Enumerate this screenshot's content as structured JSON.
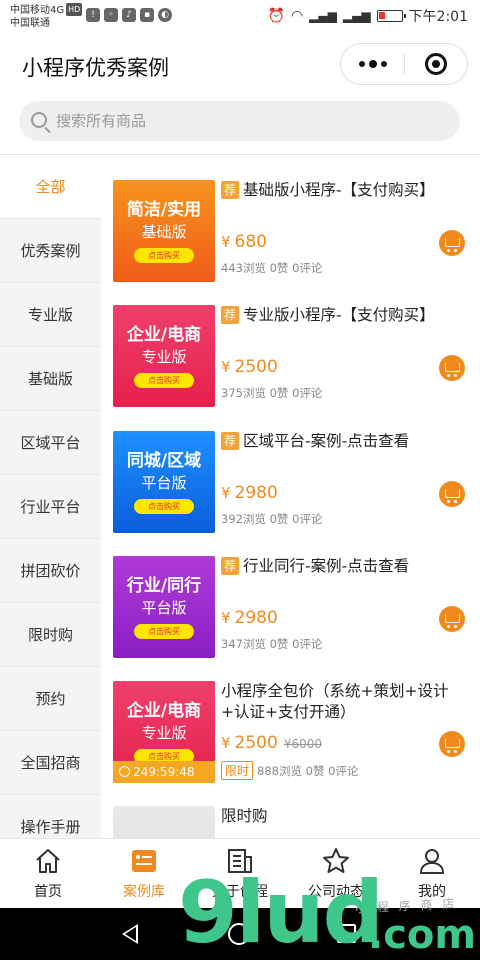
{
  "status_bar": {
    "carrier1": "中国移动4G",
    "hd": "HD",
    "carrier2": "中国联通",
    "time": "下午2:01"
  },
  "header": {
    "title": "小程序优秀案例"
  },
  "search": {
    "placeholder": "搜索所有商品"
  },
  "sidebar": {
    "items": [
      {
        "label": "全部"
      },
      {
        "label": "优秀案例"
      },
      {
        "label": "专业版"
      },
      {
        "label": "基础版"
      },
      {
        "label": "区域平台"
      },
      {
        "label": "行业平台"
      },
      {
        "label": "拼团砍价"
      },
      {
        "label": "限时购"
      },
      {
        "label": "预约"
      },
      {
        "label": "全国招商"
      },
      {
        "label": "操作手册"
      }
    ]
  },
  "products": [
    {
      "rec": "荐",
      "name": "基础版小程序-【支付购买】",
      "currency": "¥",
      "price": "680",
      "views": "443浏览",
      "likes": "0赞",
      "comments": "0评论",
      "thumb": {
        "line1": "简洁/实用",
        "line2": "基础版",
        "button": "点击购买",
        "color1": "#f7941d",
        "color2": "#f05a1a"
      }
    },
    {
      "rec": "荐",
      "name": "专业版小程序-【支付购买】",
      "currency": "¥",
      "price": "2500",
      "views": "375浏览",
      "likes": "0赞",
      "comments": "0评论",
      "thumb": {
        "line1": "企业/电商",
        "line2": "专业版",
        "button": "点击购买",
        "color1": "#f0406c",
        "color2": "#e5204c"
      }
    },
    {
      "rec": "荐",
      "name": "区域平台-案例-点击查看",
      "currency": "¥",
      "price": "2980",
      "views": "392浏览",
      "likes": "0赞",
      "comments": "0评论",
      "thumb": {
        "line1": "同城/区域",
        "line2": "平台版",
        "button": "点击购买",
        "color1": "#1e90ff",
        "color2": "#0a5fd8"
      }
    },
    {
      "rec": "荐",
      "name": "行业同行-案例-点击查看",
      "currency": "¥",
      "price": "2980",
      "views": "347浏览",
      "likes": "0赞",
      "comments": "0评论",
      "thumb": {
        "line1": "行业/同行",
        "line2": "平台版",
        "button": "点击购买",
        "color1": "#b03ad8",
        "color2": "#8a1fc4"
      }
    },
    {
      "name": "小程序全包价（系统+策划+设计+认证+支付开通）",
      "currency": "¥",
      "price": "2500",
      "old_price": "¥6000",
      "limit_tag": "限时",
      "views": "888浏览",
      "likes": "0赞",
      "comments": "0评论",
      "countdown": "249:59:48",
      "thumb": {
        "line1": "企业/电商",
        "line2": "专业版",
        "button": "点击购买",
        "color1": "#f0406c",
        "color2": "#e5204c"
      }
    },
    {
      "name": "限时购"
    }
  ],
  "tabbar": {
    "items": [
      {
        "label": "首页",
        "icon": "home-icon"
      },
      {
        "label": "案例库",
        "icon": "case-library-icon"
      },
      {
        "label": "关于创程",
        "icon": "about-icon"
      },
      {
        "label": "公司动态",
        "icon": "star-icon"
      },
      {
        "label": "我的",
        "icon": "profile-icon"
      }
    ]
  },
  "watermark": {
    "main": "9lud",
    "suffix": ".com",
    "sub": "小 程 序 商 店"
  },
  "colors": {
    "accent": "#f08a1c",
    "sidebar_bg": "#f4f4f4"
  }
}
